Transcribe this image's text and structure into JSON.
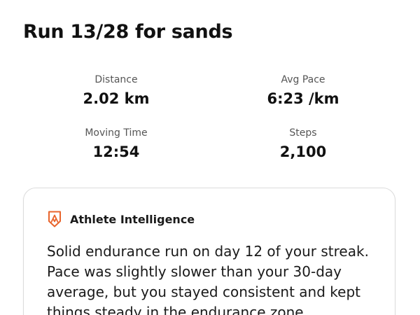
{
  "activity": {
    "title": "Run 13/28 for sands"
  },
  "stats": {
    "distance": {
      "label": "Distance",
      "value": "2.02 km"
    },
    "avg_pace": {
      "label": "Avg Pace",
      "value": "6:23 /km"
    },
    "moving_time": {
      "label": "Moving Time",
      "value": "12:54"
    },
    "steps": {
      "label": "Steps",
      "value": "2,100"
    }
  },
  "athlete_intelligence": {
    "icon": "athlete-intelligence-icon",
    "accent_color": "#e8642c",
    "title": "Athlete Intelligence",
    "summary": "Solid endurance run on day 12 of your streak. Pace was slightly slower than your 30-day average, but you stayed consistent and kept things steady in the endurance zone."
  }
}
